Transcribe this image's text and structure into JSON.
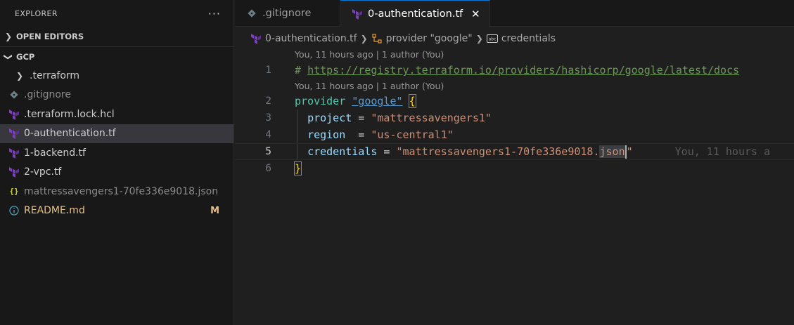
{
  "explorer": {
    "title": "EXPLORER",
    "more": "···",
    "open_editors": "OPEN EDITORS",
    "workspace": "GCP",
    "files": [
      {
        "name": ".terraform",
        "type": "folder"
      },
      {
        "name": ".gitignore",
        "type": "git"
      },
      {
        "name": ".terraform.lock.hcl",
        "type": "terraform"
      },
      {
        "name": "0-authentication.tf",
        "type": "terraform"
      },
      {
        "name": "1-backend.tf",
        "type": "terraform"
      },
      {
        "name": "2-vpc.tf",
        "type": "terraform"
      },
      {
        "name": "mattressavengers1-70fe336e9018.json",
        "type": "json"
      },
      {
        "name": "README.md",
        "type": "info",
        "badge": "M"
      }
    ]
  },
  "tabs": [
    {
      "label": ".gitignore",
      "active": false
    },
    {
      "label": "0-authentication.tf",
      "active": true,
      "close": "✕"
    }
  ],
  "breadcrumb": {
    "file": "0-authentication.tf",
    "block": "provider \"google\"",
    "attr": "credentials"
  },
  "editor": {
    "lens1": "You, 11 hours ago | 1 author (You)",
    "lens2": "You, 11 hours ago | 1 author (You)",
    "line_numbers": [
      "1",
      "2",
      "3",
      "4",
      "5",
      "6"
    ],
    "line1": {
      "hash": "# ",
      "url": "https://registry.terraform.io/providers/hashicorp/google/latest/docs"
    },
    "line2": {
      "kw": "provider",
      "name": "\"google\"",
      "brace": "{"
    },
    "line3": {
      "key": "project",
      "eq": " = ",
      "val": "\"mattressavengers1\""
    },
    "line4": {
      "key": "region",
      "eq": "  = ",
      "val": "\"us-central1\""
    },
    "line5": {
      "key": "credentials",
      "eq": " = ",
      "val_start": "\"mattressavengers1-70fe336e9018.",
      "val_sel": "json",
      "val_end": "\"",
      "blame": "You, 11 hours a"
    },
    "line6": {
      "brace": "}"
    }
  },
  "colors": {
    "accent": "#0078d4",
    "terraform_icon": "#7b42bc",
    "json_icon": "#cbcb41",
    "info_icon": "#519aba",
    "modified": "#e2c08d"
  }
}
